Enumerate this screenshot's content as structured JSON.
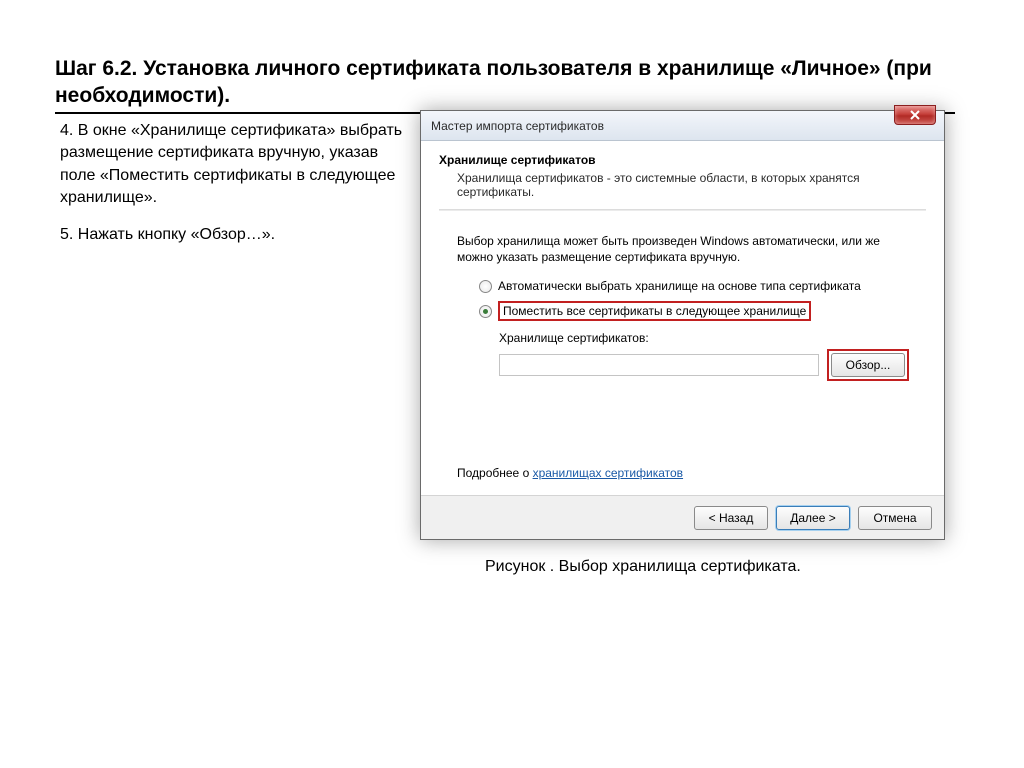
{
  "page": {
    "title": "Шаг 6.2. Установка личного сертификата пользователя в хранилище «Личное» (при необходимости).",
    "instruction_4": "4. В окне «Хранилище сертификата» выбрать размещение сертификата вручную, указав поле «Поместить сертификаты в следующее хранилище».",
    "instruction_5": "5. Нажать кнопку «Обзор…».",
    "caption": "Рисунок . Выбор хранилища сертификата."
  },
  "dialog": {
    "title": "Мастер импорта сертификатов",
    "section_head": "Хранилище сертификатов",
    "section_sub": "Хранилища сертификатов - это системные области, в которых хранятся сертификаты.",
    "body_text": "Выбор хранилища может быть произведен Windows автоматически, или же можно указать размещение сертификата вручную.",
    "radio_auto": "Автоматически выбрать хранилище на основе типа сертификата",
    "radio_manual": "Поместить все сертификаты в следующее хранилище",
    "store_label": "Хранилище сертификатов:",
    "store_value": "",
    "browse_btn": "Обзор...",
    "more_prefix": "Подробнее о ",
    "more_link": "хранилищах сертификатов",
    "btn_back": "< Назад",
    "btn_next": "Далее >",
    "btn_cancel": "Отмена"
  }
}
